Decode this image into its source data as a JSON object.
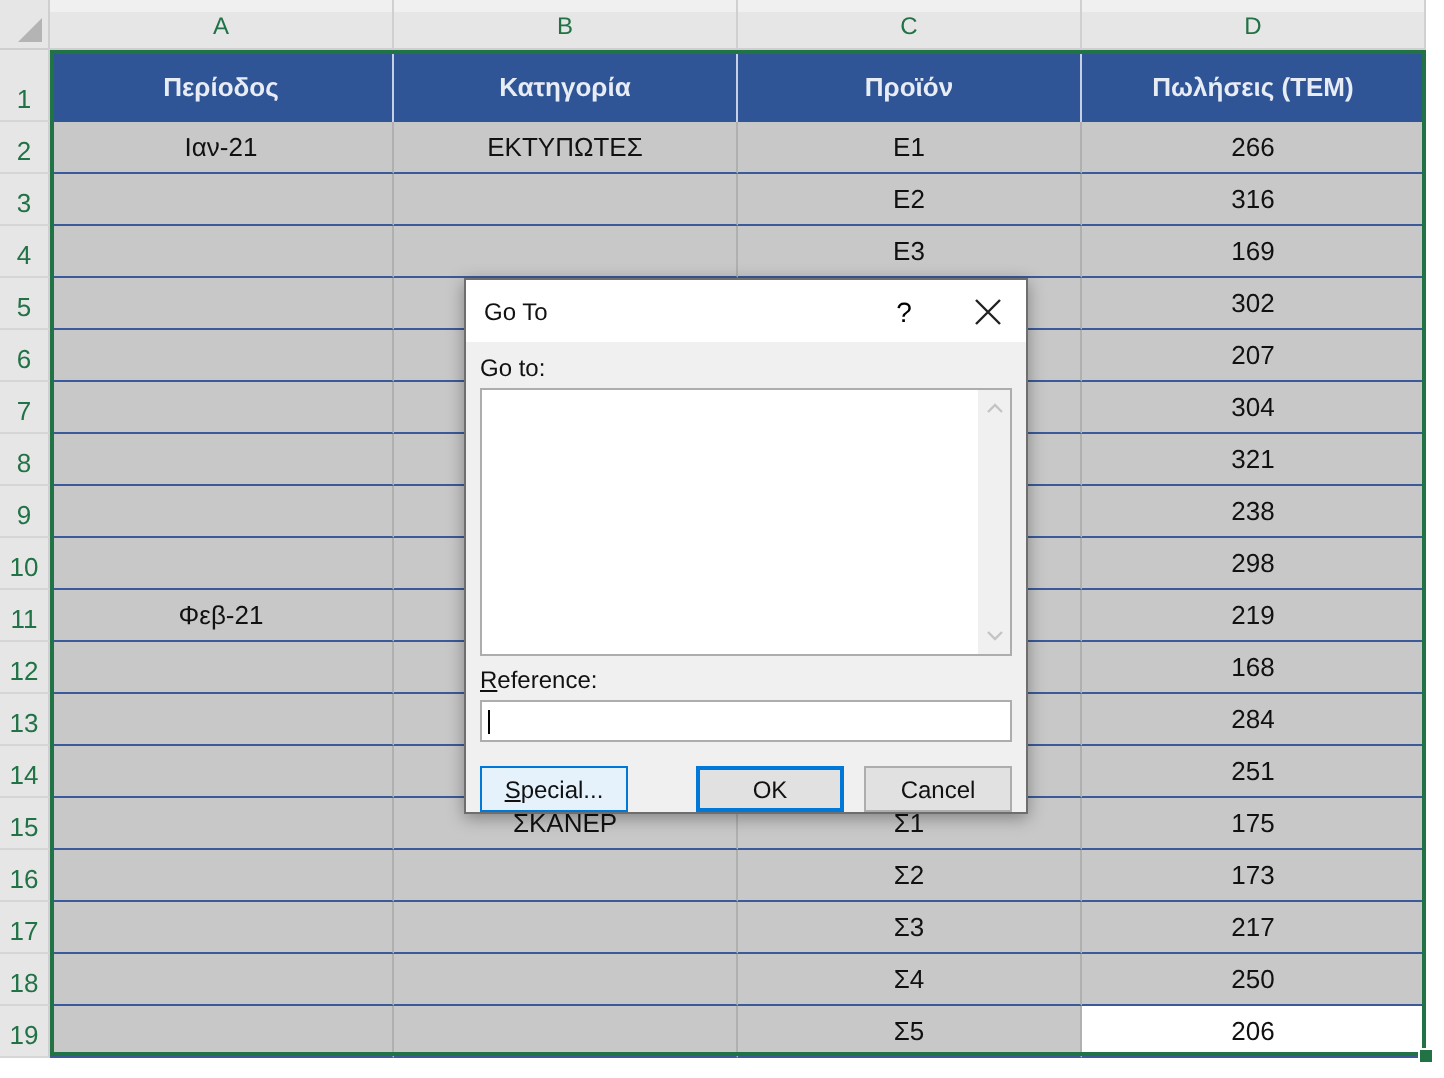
{
  "sheet": {
    "columns": [
      "A",
      "B",
      "C",
      "D"
    ],
    "rows": [
      {
        "number": "1",
        "kind": "header",
        "cells": [
          {
            "text": "Περίοδος",
            "selected": false
          },
          {
            "text": "Κατηγορία",
            "selected": false
          },
          {
            "text": "Προϊόν",
            "selected": false
          },
          {
            "text": "Πωλήσεις (ΤΕΜ)",
            "selected": false
          }
        ]
      },
      {
        "number": "2",
        "kind": "data",
        "cells": [
          {
            "text": "Ιαν-21",
            "selected": false
          },
          {
            "text": "ΕΚΤΥΠΩΤΕΣ",
            "selected": false
          },
          {
            "text": "Ε1",
            "selected": false
          },
          {
            "text": "266",
            "selected": false
          }
        ]
      },
      {
        "number": "3",
        "kind": "data",
        "cells": [
          {
            "selected": false
          },
          {
            "selected": false
          },
          {
            "text": "Ε2",
            "selected": false
          },
          {
            "text": "316",
            "selected": false
          }
        ]
      },
      {
        "number": "4",
        "kind": "data",
        "cells": [
          {
            "selected": false
          },
          {
            "selected": false
          },
          {
            "text": "Ε3",
            "selected": false
          },
          {
            "text": "169",
            "selected": false
          }
        ]
      },
      {
        "number": "5",
        "kind": "data",
        "cells": [
          {
            "selected": false
          },
          {
            "selected": false
          },
          {
            "selected": false
          },
          {
            "text": "302",
            "selected": false
          }
        ]
      },
      {
        "number": "6",
        "kind": "data",
        "cells": [
          {
            "selected": false
          },
          {
            "selected": false
          },
          {
            "selected": false
          },
          {
            "text": "207",
            "selected": false
          }
        ]
      },
      {
        "number": "7",
        "kind": "data",
        "cells": [
          {
            "selected": false
          },
          {
            "selected": false
          },
          {
            "selected": false
          },
          {
            "text": "304",
            "selected": false
          }
        ]
      },
      {
        "number": "8",
        "kind": "data",
        "cells": [
          {
            "selected": false
          },
          {
            "selected": false
          },
          {
            "selected": false
          },
          {
            "text": "321",
            "selected": false
          }
        ]
      },
      {
        "number": "9",
        "kind": "data",
        "cells": [
          {
            "selected": false
          },
          {
            "selected": false
          },
          {
            "selected": false
          },
          {
            "text": "238",
            "selected": false
          }
        ]
      },
      {
        "number": "10",
        "kind": "data",
        "cells": [
          {
            "selected": false
          },
          {
            "selected": false
          },
          {
            "selected": false
          },
          {
            "text": "298",
            "selected": false
          }
        ]
      },
      {
        "number": "11",
        "kind": "data",
        "cells": [
          {
            "text": "Φεβ-21",
            "selected": false
          },
          {
            "selected": false
          },
          {
            "selected": false
          },
          {
            "text": "219",
            "selected": false
          }
        ]
      },
      {
        "number": "12",
        "kind": "data",
        "cells": [
          {
            "selected": false
          },
          {
            "selected": false
          },
          {
            "selected": false
          },
          {
            "text": "168",
            "selected": false
          }
        ]
      },
      {
        "number": "13",
        "kind": "data",
        "cells": [
          {
            "selected": false
          },
          {
            "selected": false
          },
          {
            "selected": false
          },
          {
            "text": "284",
            "selected": false
          }
        ]
      },
      {
        "number": "14",
        "kind": "data",
        "cells": [
          {
            "selected": false
          },
          {
            "selected": false
          },
          {
            "selected": false
          },
          {
            "text": "251",
            "selected": false
          }
        ]
      },
      {
        "number": "15",
        "kind": "data",
        "cells": [
          {
            "selected": false
          },
          {
            "text": "ΣΚΑΝΕΡ",
            "selected": false
          },
          {
            "text": "Σ1",
            "selected": false
          },
          {
            "text": "175",
            "selected": false
          }
        ]
      },
      {
        "number": "16",
        "kind": "data",
        "cells": [
          {
            "selected": false
          },
          {
            "selected": false
          },
          {
            "text": "Σ2",
            "selected": false
          },
          {
            "text": "173",
            "selected": false
          }
        ]
      },
      {
        "number": "17",
        "kind": "data",
        "cells": [
          {
            "selected": false
          },
          {
            "selected": false
          },
          {
            "text": "Σ3",
            "selected": false
          },
          {
            "text": "217",
            "selected": false
          }
        ]
      },
      {
        "number": "18",
        "kind": "data",
        "cells": [
          {
            "selected": false
          },
          {
            "selected": false
          },
          {
            "text": "Σ4",
            "selected": false
          },
          {
            "text": "250",
            "selected": false
          }
        ]
      },
      {
        "number": "19",
        "kind": "data",
        "cells": [
          {
            "selected": false
          },
          {
            "selected": false
          },
          {
            "text": "Σ5",
            "selected": false
          },
          {
            "text": "206",
            "selected": true
          }
        ]
      }
    ]
  },
  "dialog": {
    "title": "Go To",
    "help": "?",
    "goto_label": "Go to:",
    "reference_label": "Reference:",
    "buttons": [
      {
        "label": "Special...",
        "kind": "focused"
      },
      {
        "label": "OK",
        "kind": "default"
      },
      {
        "label": "Cancel",
        "kind": "normal"
      }
    ]
  }
}
